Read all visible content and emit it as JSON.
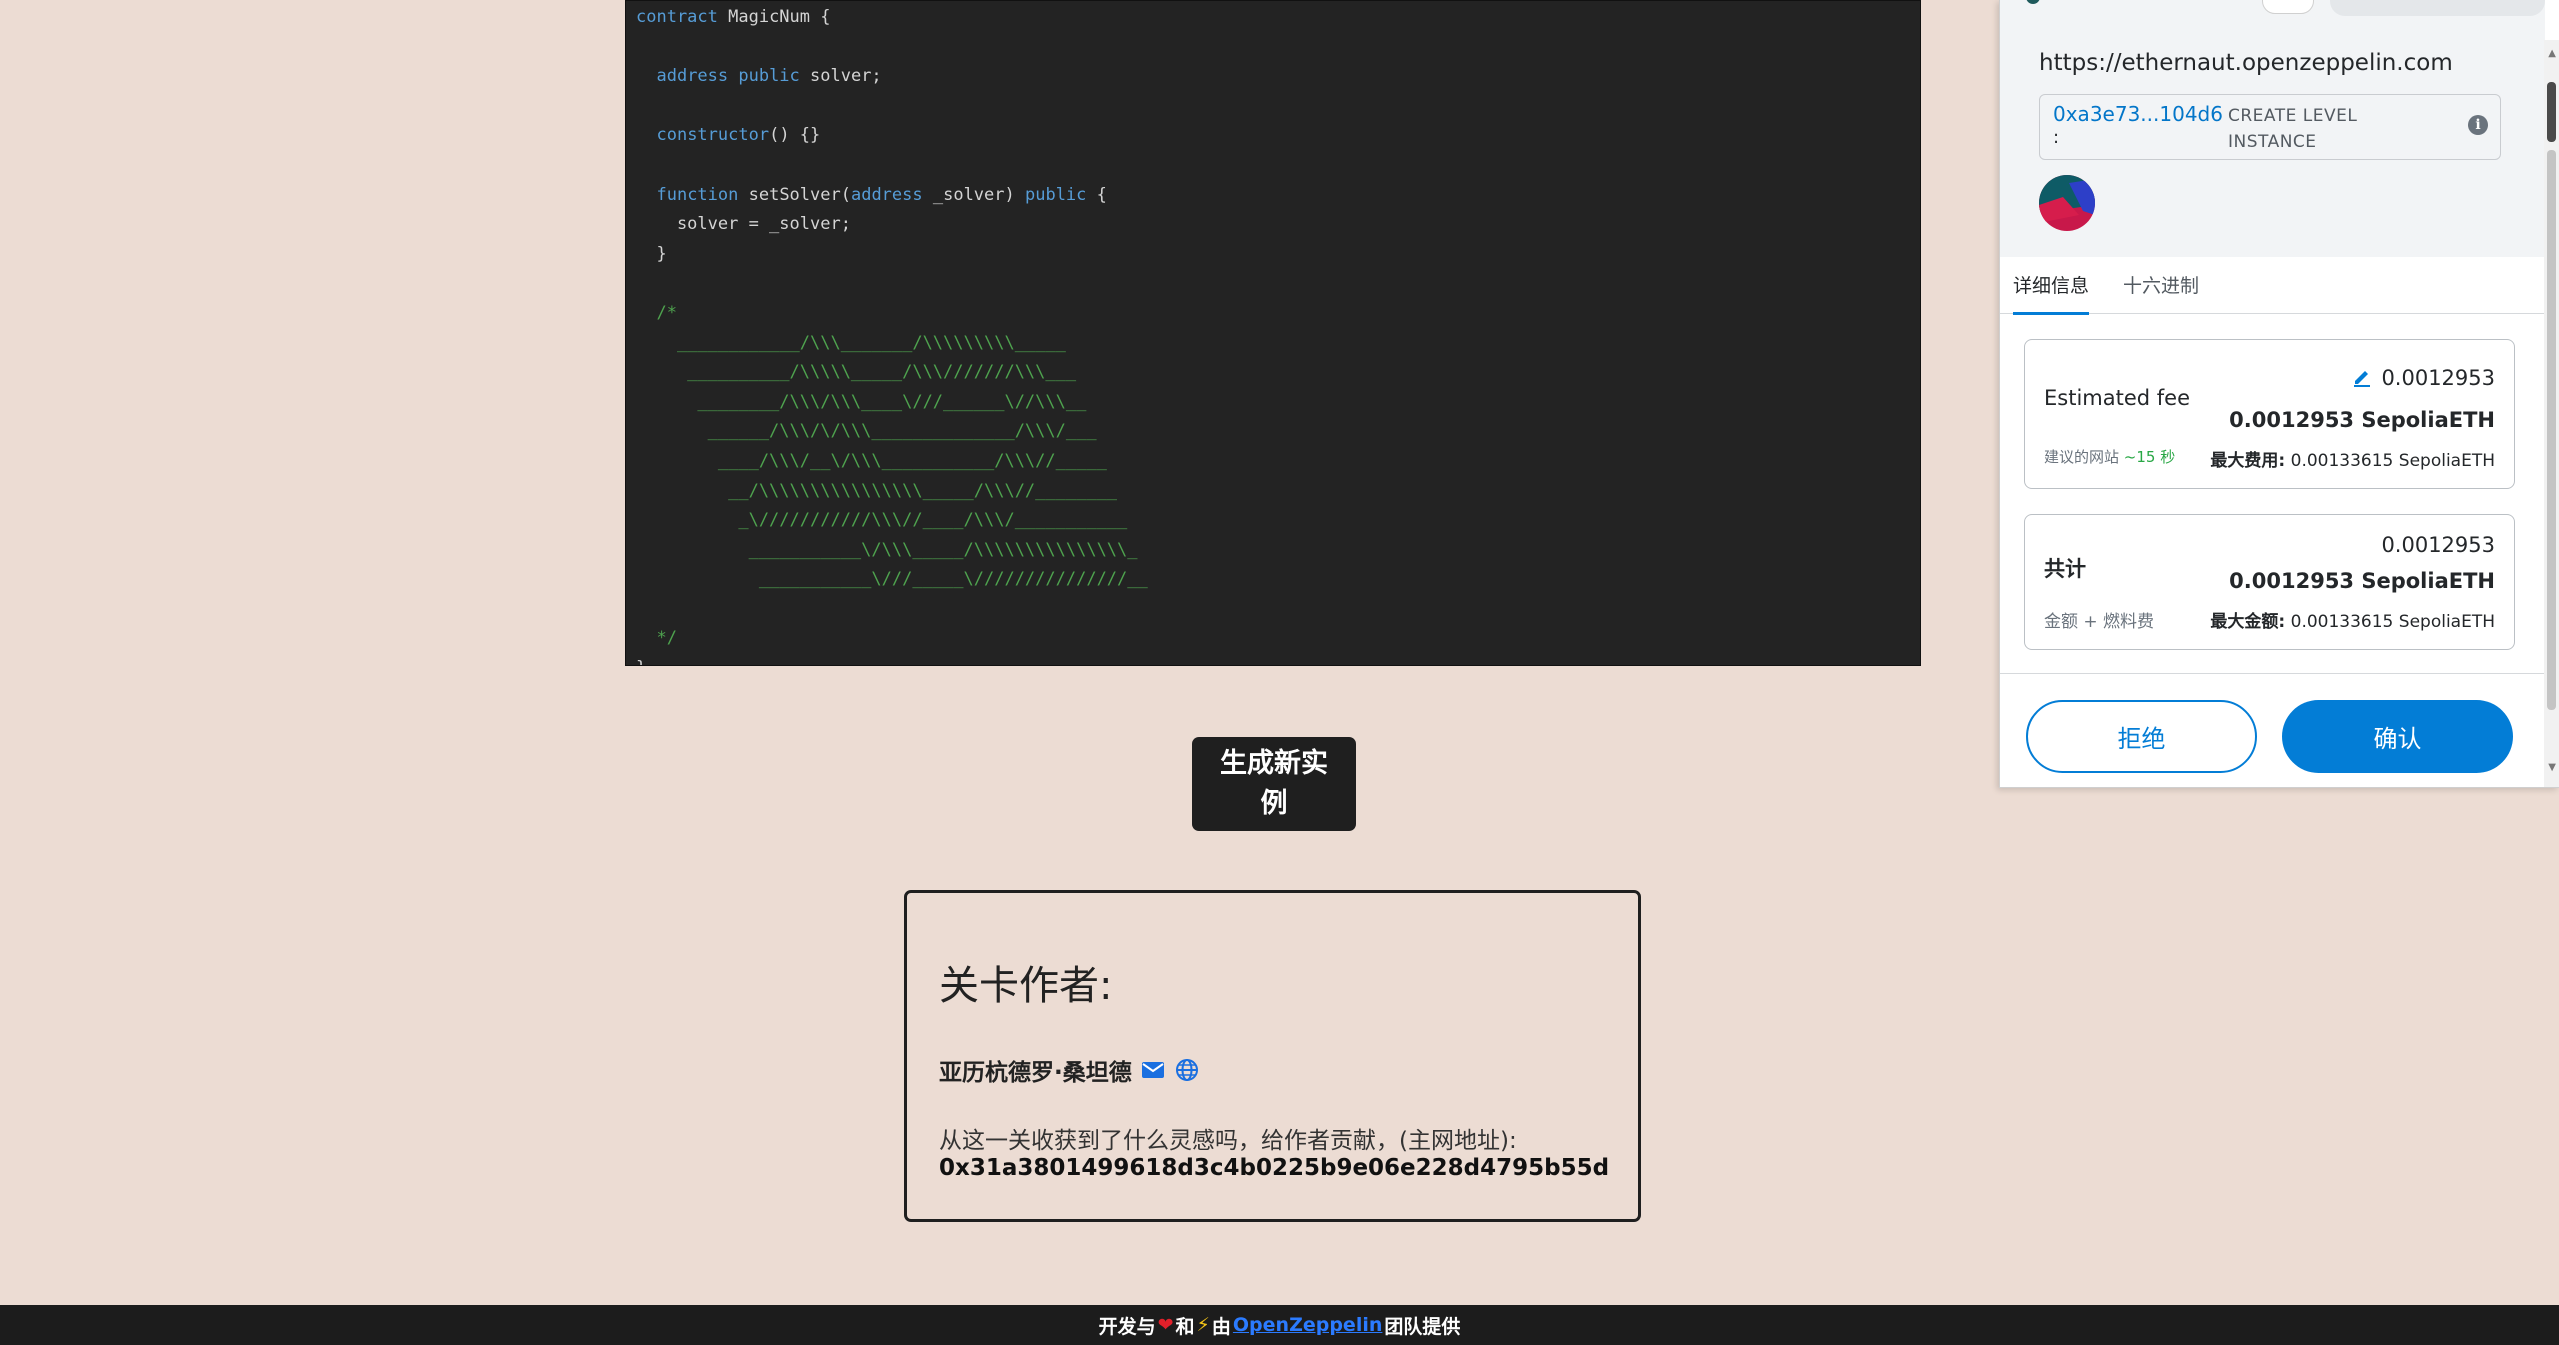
{
  "code": {
    "lines": [
      [
        {
          "t": "contract",
          "c": "kw"
        },
        {
          "t": " MagicNum {",
          "c": ""
        }
      ],
      [],
      [
        {
          "t": "  ",
          "c": ""
        },
        {
          "t": "address public",
          "c": "kw"
        },
        {
          "t": " solver;",
          "c": ""
        }
      ],
      [],
      [
        {
          "t": "  ",
          "c": ""
        },
        {
          "t": "constructor",
          "c": "kw"
        },
        {
          "t": "() {}",
          "c": ""
        }
      ],
      [],
      [
        {
          "t": "  ",
          "c": ""
        },
        {
          "t": "function",
          "c": "kw"
        },
        {
          "t": " setSolver(",
          "c": ""
        },
        {
          "t": "address",
          "c": "kw"
        },
        {
          "t": " _solver) ",
          "c": ""
        },
        {
          "t": "public",
          "c": "kw"
        },
        {
          "t": " {",
          "c": ""
        }
      ],
      [
        {
          "t": "    solver = _solver;",
          "c": ""
        }
      ],
      [
        {
          "t": "  }",
          "c": ""
        }
      ],
      [],
      [
        {
          "t": "  /*",
          "c": "cm"
        }
      ],
      [
        {
          "t": "    ____________/\\\\\\_______/\\\\\\\\\\\\\\\\\\_____",
          "c": "cm"
        }
      ],
      [
        {
          "t": "     __________/\\\\\\\\\\_____/\\\\\\///////\\\\\\___",
          "c": "cm"
        }
      ],
      [
        {
          "t": "      ________/\\\\\\/\\\\\\____\\///______\\//\\\\\\__",
          "c": "cm"
        }
      ],
      [
        {
          "t": "       ______/\\\\\\/\\/\\\\\\______________/\\\\\\/___",
          "c": "cm"
        }
      ],
      [
        {
          "t": "        ____/\\\\\\/__\\/\\\\\\___________/\\\\\\//_____",
          "c": "cm"
        }
      ],
      [
        {
          "t": "         __/\\\\\\\\\\\\\\\\\\\\\\\\\\\\\\\\_____/\\\\\\//________",
          "c": "cm"
        }
      ],
      [
        {
          "t": "          _\\///////////\\\\\\//____/\\\\\\/___________",
          "c": "cm"
        }
      ],
      [
        {
          "t": "           ___________\\/\\\\\\_____/\\\\\\\\\\\\\\\\\\\\\\\\\\\\\\_",
          "c": "cm"
        }
      ],
      [
        {
          "t": "            ___________\\///_____\\///////////////__",
          "c": "cm"
        }
      ],
      [],
      [
        {
          "t": "  */",
          "c": "cm"
        }
      ],
      [
        {
          "t": "}",
          "c": ""
        }
      ]
    ]
  },
  "actions": {
    "generate_label_line1": "生成新实",
    "generate_label_line2": "例"
  },
  "author": {
    "heading": "关卡作者:",
    "name": "亚历杭德罗·桑坦德",
    "donate_text": "从这一关收获到了什么灵感吗，给作者贡献，(主网地址):",
    "donate_address": "0x31a3801499618d3c4b0225b9e06e228d4795b55d"
  },
  "footer": {
    "prefix": "开发与",
    "heart": "❤",
    "and": "和",
    "bolt": "⚡",
    "by": "由",
    "link": "OpenZeppelin",
    "suffix": "团队提供"
  },
  "metamask": {
    "origin": "https://ethernaut.openzeppelin.com",
    "contract_address": "0xa3e73...104d6",
    "contract_colon": ":",
    "contract_action": "CREATE LEVEL INSTANCE",
    "tabs": [
      "详细信息",
      "十六进制"
    ],
    "fee": {
      "label": "Estimated fee",
      "value": "0.0012953",
      "value_eth": "0.0012953 SepoliaETH",
      "suggested_label": "建议的网站",
      "suggested_time": "~15 秒",
      "max_label": "最大费用:",
      "max_value": "0.00133615 SepoliaETH"
    },
    "total": {
      "label": "共计",
      "value": "0.0012953",
      "value_eth": "0.0012953 SepoliaETH",
      "sub_label": "金额 + 燃料费",
      "max_label": "最大金额:",
      "max_value": "0.00133615 SepoliaETH"
    },
    "reject_label": "拒绝",
    "confirm_label": "确认"
  },
  "colors": {
    "page_bg": "#ecdcd3",
    "code_bg": "#232323",
    "keyword": "#569cd6",
    "comment": "#4ea24e",
    "metamask_blue": "#037dd6"
  }
}
